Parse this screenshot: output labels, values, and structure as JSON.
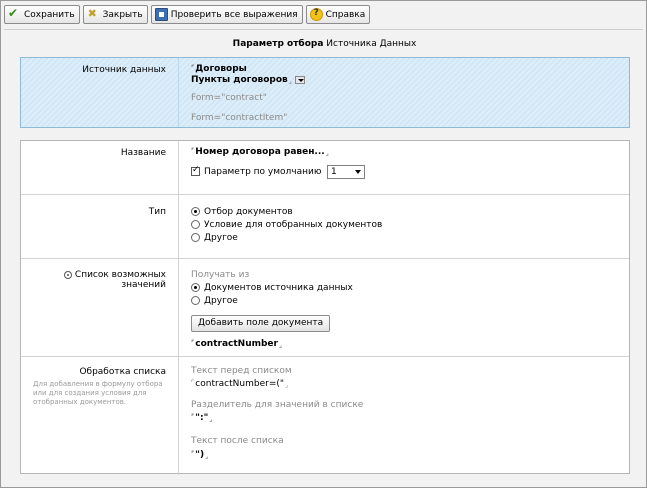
{
  "toolbar": {
    "save_label": "Сохранить",
    "close_label": "Закрыть",
    "check_label": "Проверить все выражения",
    "help_label": "Справка"
  },
  "page_title": {
    "bold": "Параметр отбора",
    "rest": "Источника Данных"
  },
  "source": {
    "label": "Источник данных",
    "item1": "Договоры",
    "item2": "Пункты договоров",
    "form1": "Form=\"contract\"",
    "form2": "Form=\"contractItem\""
  },
  "name_row": {
    "label": "Название",
    "value": "Номер договора равен...",
    "default_checkbox_label": "Параметр по умолчанию",
    "default_checked": true,
    "select_value": "1"
  },
  "type_row": {
    "label": "Тип",
    "options": [
      "Отбор документов",
      "Условие для отобранных документов",
      "Другое"
    ],
    "selected_index": 0
  },
  "values_row": {
    "label": "Список возможных значений",
    "get_from": "Получать из",
    "options": [
      "Документов источника данных",
      "Другое"
    ],
    "selected_index": 0,
    "add_button": "Добавить поле документа",
    "field": "contractNumber"
  },
  "list_row": {
    "label": "Обработка списка",
    "hint": "Для добавления в формулу отбора или для создания условия для отобранных документов.",
    "before_label": "Текст перед списком",
    "before_value": "contractNumber=(\"",
    "sep_label": "Разделитель для значений в списке",
    "sep_value": "\":\"",
    "after_label": "Текст после списка",
    "after_value": "\")"
  }
}
